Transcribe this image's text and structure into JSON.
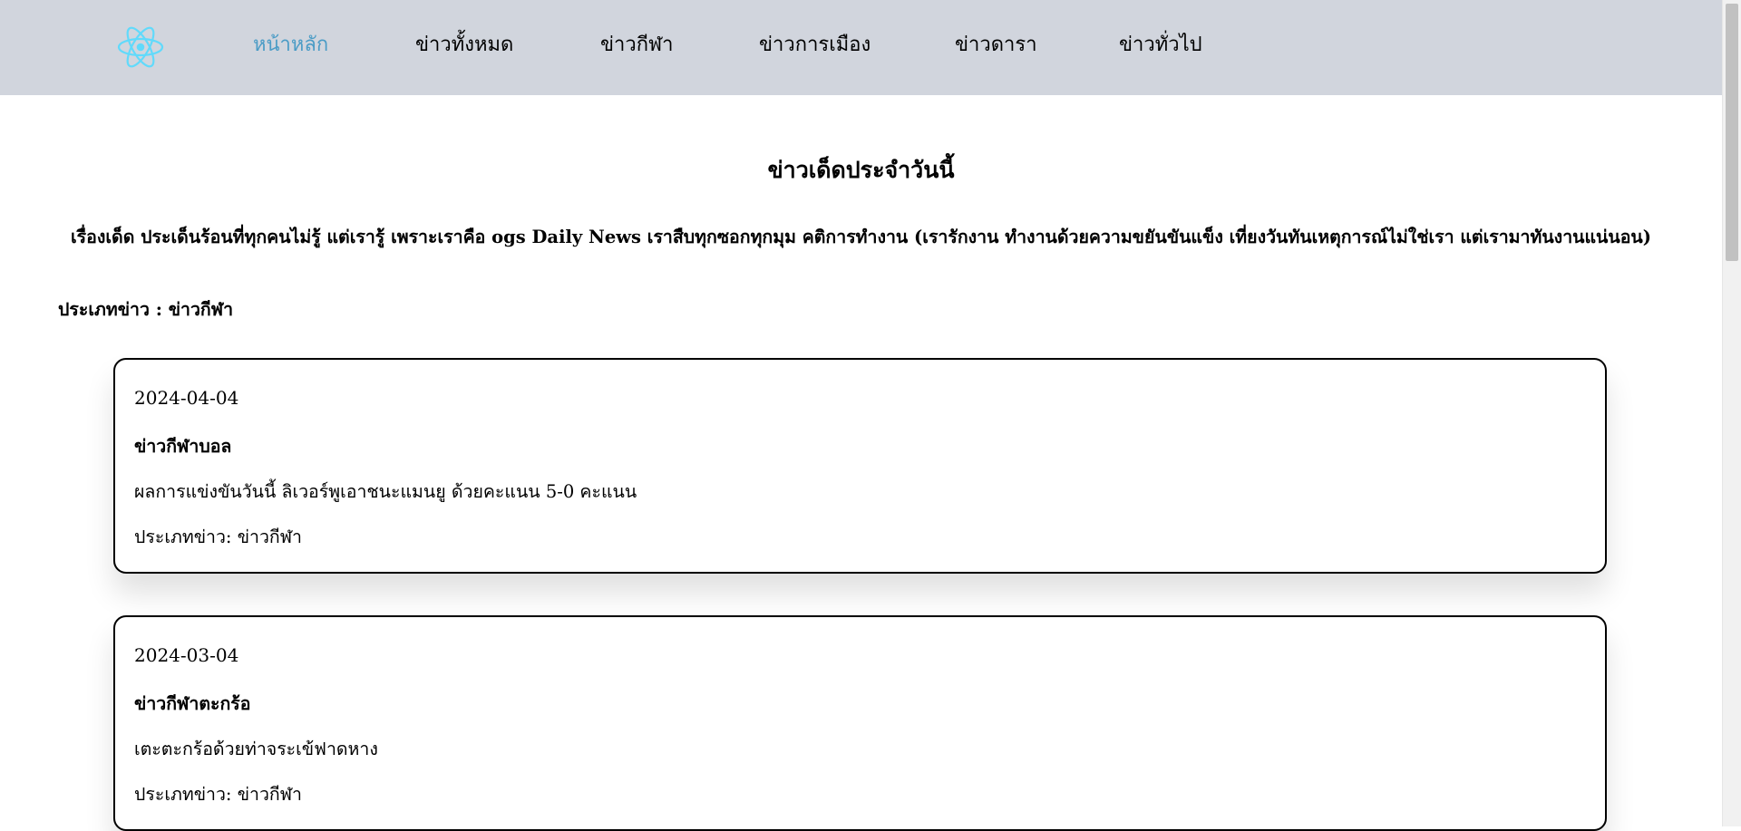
{
  "nav": {
    "logo_icon": "react-atom-icon",
    "logo_color": "#61dafb",
    "active_color": "#4b9cc6",
    "items": [
      {
        "label": "หน้าหลัก",
        "active": true
      },
      {
        "label": "ข่าวทั้งหมด",
        "active": false
      },
      {
        "label": "ข่าวกีฬา",
        "active": false
      },
      {
        "label": "ข่าวการเมือง",
        "active": false
      },
      {
        "label": "ข่าวดารา",
        "active": false
      },
      {
        "label": "ข่าวทั่วไป",
        "active": false
      }
    ]
  },
  "main": {
    "headline": "ข่าวเด็ดประจำวันนี้",
    "tagline": "เรื่องเด็ด ประเด็นร้อนที่ทุกคนไม่รู้ แต่เรารู้ เพราะเราคือ ogs Daily News เราสืบทุกซอกทุกมุม คติการทำงาน (เรารักงาน ทำงานด้วยความขยันขันแข็ง เที่ยงวันทันเหตุการณ์ไม่ใช่เรา แต่เรามาทันงานแน่นอน)",
    "category_label": "ประเภทข่าว : ข่าวกีฬา"
  },
  "news": [
    {
      "date": "2024-04-04",
      "title": "ข่าวกีฬาบอล",
      "description": "ผลการแข่งขันวันนี้ ลิเวอร์พูเอาชนะแมนยู ด้วยคะแนน 5-0 คะแนน",
      "type": "ประเภทข่าว: ข่าวกีฬา"
    },
    {
      "date": "2024-03-04",
      "title": "ข่าวกีฬาตะกร้อ",
      "description": "เตะตะกร้อด้วยท่าจระเข้ฟาดหาง",
      "type": "ประเภทข่าว: ข่าวกีฬา"
    }
  ]
}
